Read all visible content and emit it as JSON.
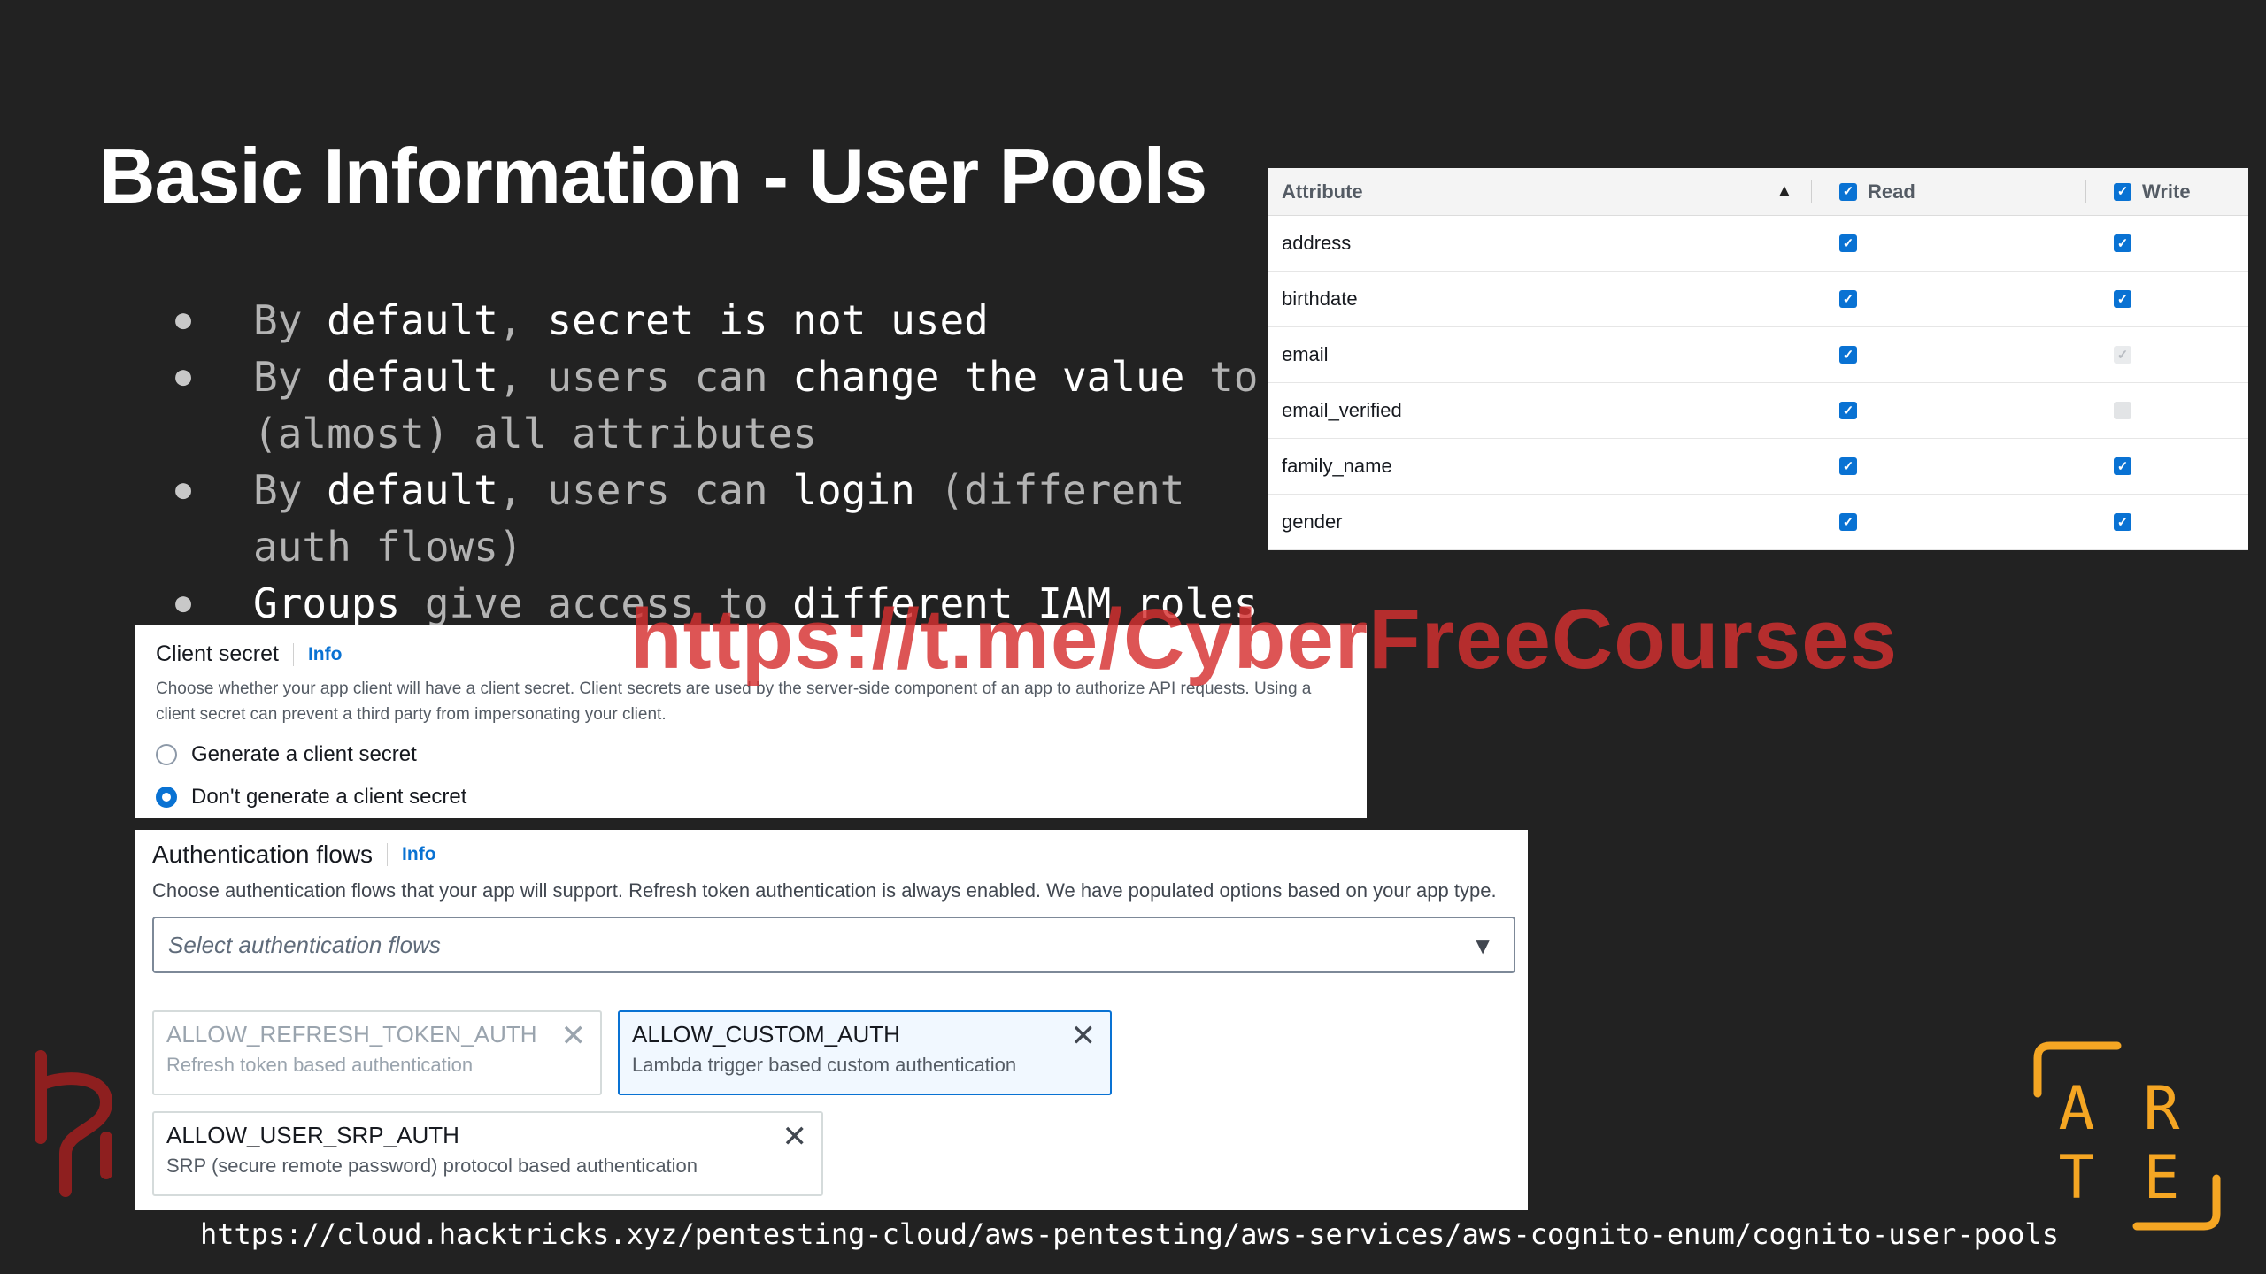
{
  "slide": {
    "title": "Basic Information - User Pools",
    "bullets": [
      [
        {
          "t": "By ",
          "s": "dim"
        },
        {
          "t": "default",
          "s": "hl"
        },
        {
          "t": ", ",
          "s": "dim"
        },
        {
          "t": "secret is not used",
          "s": "hl"
        }
      ],
      [
        {
          "t": "By ",
          "s": "dim"
        },
        {
          "t": "default",
          "s": "hl"
        },
        {
          "t": ", users can ",
          "s": "dim"
        },
        {
          "t": "change the value",
          "s": "hl"
        },
        {
          "t": " to (almost) all attributes",
          "s": "dim"
        }
      ],
      [
        {
          "t": "By ",
          "s": "dim"
        },
        {
          "t": "default",
          "s": "hl"
        },
        {
          "t": ", users can ",
          "s": "dim"
        },
        {
          "t": "login",
          "s": "hl"
        },
        {
          "t": " (different auth flows)",
          "s": "dim"
        }
      ],
      [
        {
          "t": "Groups",
          "s": "hl"
        },
        {
          "t": " give access to ",
          "s": "dim"
        },
        {
          "t": "different IAM roles",
          "s": "hl"
        }
      ]
    ]
  },
  "attribute_table": {
    "headers": {
      "attribute": "Attribute",
      "read": "Read",
      "write": "Write"
    },
    "sort": "ascending",
    "rows": [
      {
        "name": "address",
        "read": "checked",
        "write": "checked"
      },
      {
        "name": "birthdate",
        "read": "checked",
        "write": "checked"
      },
      {
        "name": "email",
        "read": "checked",
        "write": "disabled-checked"
      },
      {
        "name": "email_verified",
        "read": "checked",
        "write": "disabled-empty"
      },
      {
        "name": "family_name",
        "read": "checked",
        "write": "checked"
      },
      {
        "name": "gender",
        "read": "checked",
        "write": "checked"
      }
    ]
  },
  "client_secret": {
    "title": "Client secret",
    "info": "Info",
    "description": "Choose whether your app client will have a client secret. Client secrets are used by the server-side component of an app to authorize API requests. Using a client secret can prevent a third party from impersonating your client.",
    "options": [
      {
        "label": "Generate a client secret",
        "selected": false
      },
      {
        "label": "Don't generate a client secret",
        "selected": true
      }
    ]
  },
  "auth_flows": {
    "title": "Authentication flows",
    "info": "Info",
    "description": "Choose authentication flows that your app will support. Refresh token authentication is always enabled. We have populated options based on your app type.",
    "placeholder": "Select authentication flows",
    "tokens": [
      {
        "name": "ALLOW_REFRESH_TOKEN_AUTH",
        "desc": "Refresh token based authentication",
        "state": "dimmed"
      },
      {
        "name": "ALLOW_CUSTOM_AUTH",
        "desc": "Lambda trigger based custom authentication",
        "state": "active"
      },
      {
        "name": "ALLOW_USER_SRP_AUTH",
        "desc": "SRP (secure remote password) protocol based authentication",
        "state": "normal"
      }
    ]
  },
  "watermark": "https://t.me/CyberFreeCourses",
  "footer_url": "https://cloud.hacktricks.xyz/pentesting-cloud/aws-pentesting/aws-services/aws-cognito-enum/cognito-user-pools",
  "logos": {
    "arte": {
      "letters": [
        "A",
        "R",
        "T",
        "E"
      ],
      "color": "#f5a623"
    },
    "hacktricks": {
      "color": "#8e1f1f"
    }
  }
}
